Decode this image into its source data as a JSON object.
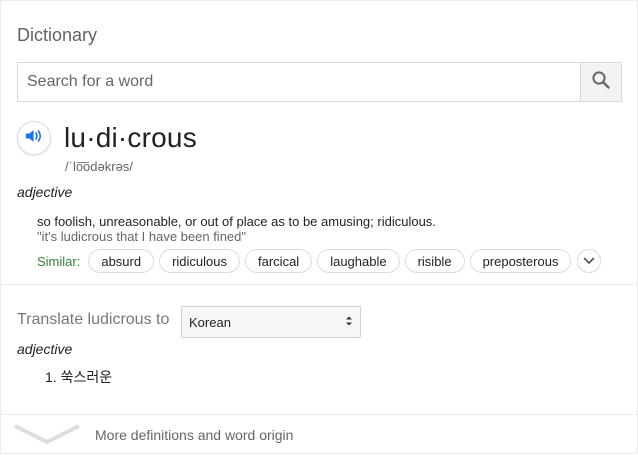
{
  "header": {
    "title": "Dictionary"
  },
  "search": {
    "placeholder": "Search for a word",
    "value": ""
  },
  "entry": {
    "headword": "lu·di·crous",
    "phonetic": "/ˈlo͞odəkrəs/",
    "part_of_speech": "adjective",
    "definition": "so foolish, unreasonable, or out of place as to be amusing; ridiculous.",
    "example": "\"it's ludicrous that I have been fined\"",
    "similar_label": "Similar:",
    "similar": [
      "absurd",
      "ridiculous",
      "farcical",
      "laughable",
      "risible",
      "preposterous"
    ]
  },
  "translate": {
    "label": "Translate ludicrous to",
    "language": "Korean",
    "part_of_speech": "adjective",
    "items": [
      "1. 쑥스러운"
    ]
  },
  "footer": {
    "more_label": "More definitions and word origin"
  },
  "colors": {
    "similar_label": "#36813b",
    "speaker_icon": "#1a73e8"
  },
  "icons": [
    "search-icon",
    "speaker-icon",
    "chevron-down-icon",
    "select-arrows-icon",
    "wide-chevron-icon"
  ]
}
